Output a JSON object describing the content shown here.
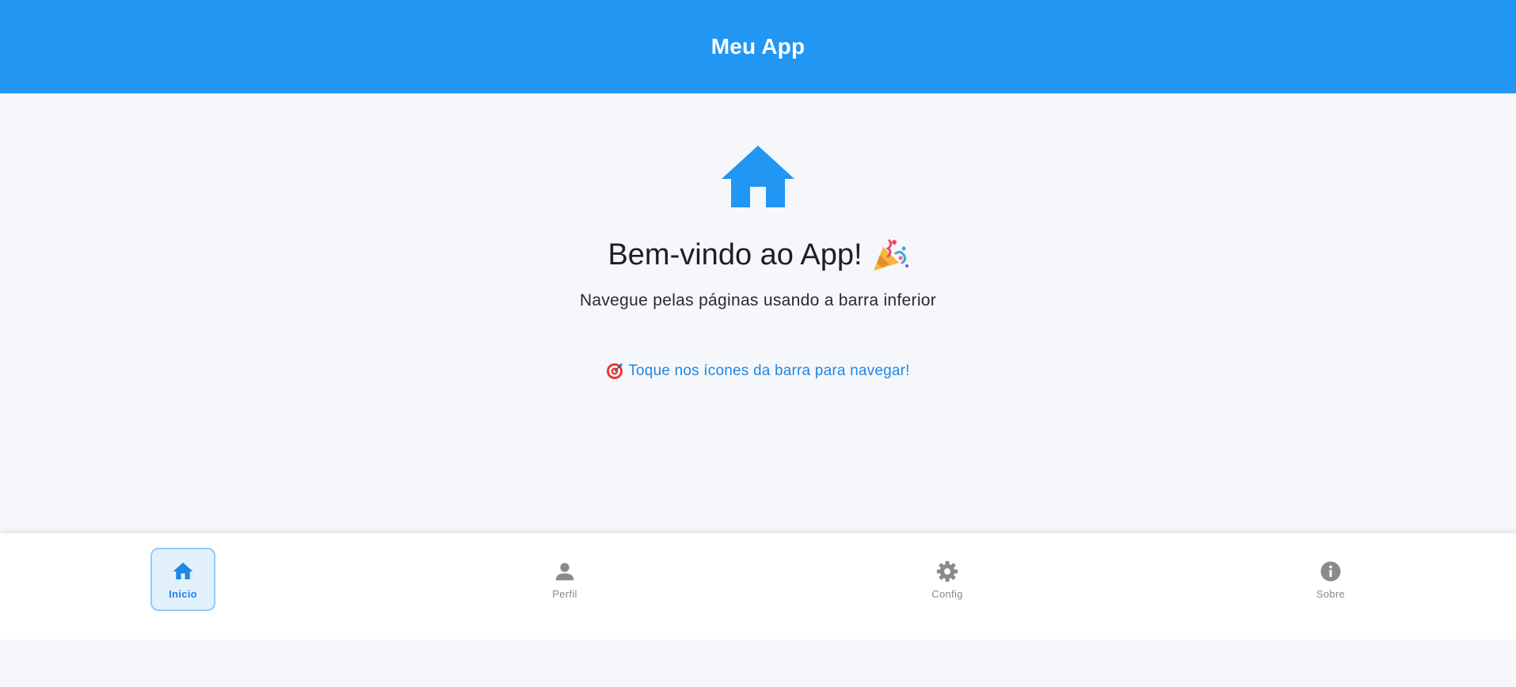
{
  "appbar": {
    "title": "Meu App"
  },
  "hero": {
    "icon": "home-icon",
    "welcome": "Bem-vindo ao App!",
    "welcome_emoji": "party-popper-icon",
    "subtitle": "Navegue pelas páginas usando a barra inferior",
    "hint_emoji": "target-icon",
    "hint": "Toque nos ícones da barra para navegar!"
  },
  "nav": {
    "items": [
      {
        "label": "Início",
        "icon": "home-icon",
        "active": true
      },
      {
        "label": "Perfil",
        "icon": "person-icon",
        "active": false
      },
      {
        "label": "Config",
        "icon": "gear-icon",
        "active": false
      },
      {
        "label": "Sobre",
        "icon": "info-icon",
        "active": false
      }
    ]
  },
  "colors": {
    "primary": "#2196f3",
    "background": "#f6f7fb",
    "active_text": "#1e88e5",
    "inactive": "#8a8a8a"
  }
}
